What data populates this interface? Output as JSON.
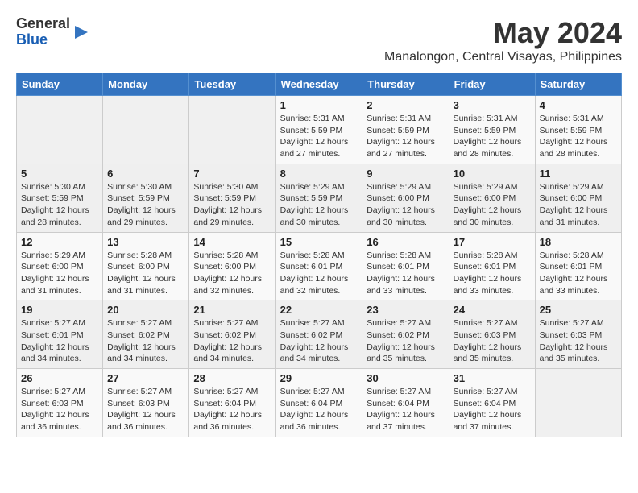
{
  "header": {
    "logo_general": "General",
    "logo_blue": "Blue",
    "month_title": "May 2024",
    "location": "Manalongon, Central Visayas, Philippines"
  },
  "days_of_week": [
    "Sunday",
    "Monday",
    "Tuesday",
    "Wednesday",
    "Thursday",
    "Friday",
    "Saturday"
  ],
  "weeks": [
    [
      {
        "day": "",
        "info": ""
      },
      {
        "day": "",
        "info": ""
      },
      {
        "day": "",
        "info": ""
      },
      {
        "day": "1",
        "info": "Sunrise: 5:31 AM\nSunset: 5:59 PM\nDaylight: 12 hours and 27 minutes."
      },
      {
        "day": "2",
        "info": "Sunrise: 5:31 AM\nSunset: 5:59 PM\nDaylight: 12 hours and 27 minutes."
      },
      {
        "day": "3",
        "info": "Sunrise: 5:31 AM\nSunset: 5:59 PM\nDaylight: 12 hours and 28 minutes."
      },
      {
        "day": "4",
        "info": "Sunrise: 5:31 AM\nSunset: 5:59 PM\nDaylight: 12 hours and 28 minutes."
      }
    ],
    [
      {
        "day": "5",
        "info": "Sunrise: 5:30 AM\nSunset: 5:59 PM\nDaylight: 12 hours and 28 minutes."
      },
      {
        "day": "6",
        "info": "Sunrise: 5:30 AM\nSunset: 5:59 PM\nDaylight: 12 hours and 29 minutes."
      },
      {
        "day": "7",
        "info": "Sunrise: 5:30 AM\nSunset: 5:59 PM\nDaylight: 12 hours and 29 minutes."
      },
      {
        "day": "8",
        "info": "Sunrise: 5:29 AM\nSunset: 5:59 PM\nDaylight: 12 hours and 30 minutes."
      },
      {
        "day": "9",
        "info": "Sunrise: 5:29 AM\nSunset: 6:00 PM\nDaylight: 12 hours and 30 minutes."
      },
      {
        "day": "10",
        "info": "Sunrise: 5:29 AM\nSunset: 6:00 PM\nDaylight: 12 hours and 30 minutes."
      },
      {
        "day": "11",
        "info": "Sunrise: 5:29 AM\nSunset: 6:00 PM\nDaylight: 12 hours and 31 minutes."
      }
    ],
    [
      {
        "day": "12",
        "info": "Sunrise: 5:29 AM\nSunset: 6:00 PM\nDaylight: 12 hours and 31 minutes."
      },
      {
        "day": "13",
        "info": "Sunrise: 5:28 AM\nSunset: 6:00 PM\nDaylight: 12 hours and 31 minutes."
      },
      {
        "day": "14",
        "info": "Sunrise: 5:28 AM\nSunset: 6:00 PM\nDaylight: 12 hours and 32 minutes."
      },
      {
        "day": "15",
        "info": "Sunrise: 5:28 AM\nSunset: 6:01 PM\nDaylight: 12 hours and 32 minutes."
      },
      {
        "day": "16",
        "info": "Sunrise: 5:28 AM\nSunset: 6:01 PM\nDaylight: 12 hours and 33 minutes."
      },
      {
        "day": "17",
        "info": "Sunrise: 5:28 AM\nSunset: 6:01 PM\nDaylight: 12 hours and 33 minutes."
      },
      {
        "day": "18",
        "info": "Sunrise: 5:28 AM\nSunset: 6:01 PM\nDaylight: 12 hours and 33 minutes."
      }
    ],
    [
      {
        "day": "19",
        "info": "Sunrise: 5:27 AM\nSunset: 6:01 PM\nDaylight: 12 hours and 34 minutes."
      },
      {
        "day": "20",
        "info": "Sunrise: 5:27 AM\nSunset: 6:02 PM\nDaylight: 12 hours and 34 minutes."
      },
      {
        "day": "21",
        "info": "Sunrise: 5:27 AM\nSunset: 6:02 PM\nDaylight: 12 hours and 34 minutes."
      },
      {
        "day": "22",
        "info": "Sunrise: 5:27 AM\nSunset: 6:02 PM\nDaylight: 12 hours and 34 minutes."
      },
      {
        "day": "23",
        "info": "Sunrise: 5:27 AM\nSunset: 6:02 PM\nDaylight: 12 hours and 35 minutes."
      },
      {
        "day": "24",
        "info": "Sunrise: 5:27 AM\nSunset: 6:03 PM\nDaylight: 12 hours and 35 minutes."
      },
      {
        "day": "25",
        "info": "Sunrise: 5:27 AM\nSunset: 6:03 PM\nDaylight: 12 hours and 35 minutes."
      }
    ],
    [
      {
        "day": "26",
        "info": "Sunrise: 5:27 AM\nSunset: 6:03 PM\nDaylight: 12 hours and 36 minutes."
      },
      {
        "day": "27",
        "info": "Sunrise: 5:27 AM\nSunset: 6:03 PM\nDaylight: 12 hours and 36 minutes."
      },
      {
        "day": "28",
        "info": "Sunrise: 5:27 AM\nSunset: 6:04 PM\nDaylight: 12 hours and 36 minutes."
      },
      {
        "day": "29",
        "info": "Sunrise: 5:27 AM\nSunset: 6:04 PM\nDaylight: 12 hours and 36 minutes."
      },
      {
        "day": "30",
        "info": "Sunrise: 5:27 AM\nSunset: 6:04 PM\nDaylight: 12 hours and 37 minutes."
      },
      {
        "day": "31",
        "info": "Sunrise: 5:27 AM\nSunset: 6:04 PM\nDaylight: 12 hours and 37 minutes."
      },
      {
        "day": "",
        "info": ""
      }
    ]
  ]
}
